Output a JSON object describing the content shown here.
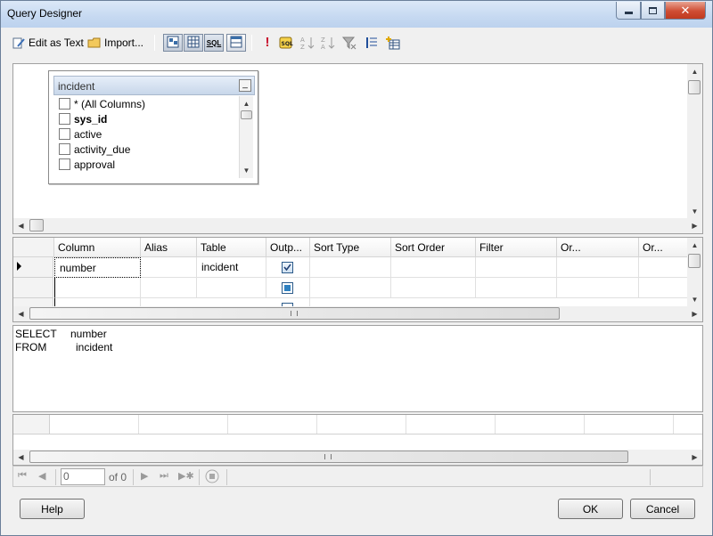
{
  "window": {
    "title": "Query Designer"
  },
  "toolbar": {
    "edit_as_text": "Edit as Text",
    "import": "Import...",
    "sql_label": "SQL"
  },
  "diagram": {
    "table": {
      "name": "incident",
      "minimize_glyph": "_",
      "columns": [
        "* (All Columns)",
        "sys_id",
        "active",
        "activity_due",
        "approval"
      ]
    }
  },
  "grid": {
    "headers": [
      "Column",
      "Alias",
      "Table",
      "Outp...",
      "Sort Type",
      "Sort Order",
      "Filter",
      "Or...",
      "Or..."
    ],
    "rows": [
      {
        "column": "number",
        "alias": "",
        "table": "incident",
        "output": true
      }
    ]
  },
  "sql": {
    "line1_keyword": "SELECT",
    "line1_value": "number",
    "line2_keyword": "FROM",
    "line2_value": "incident"
  },
  "navigator": {
    "page_value": "0",
    "of_label": "of 0"
  },
  "footer": {
    "help": "Help",
    "ok": "OK",
    "cancel": "Cancel"
  },
  "colors": {
    "titlebar": "#c6d9f1",
    "close": "#cf4d33",
    "accent": "#2e80c0"
  }
}
